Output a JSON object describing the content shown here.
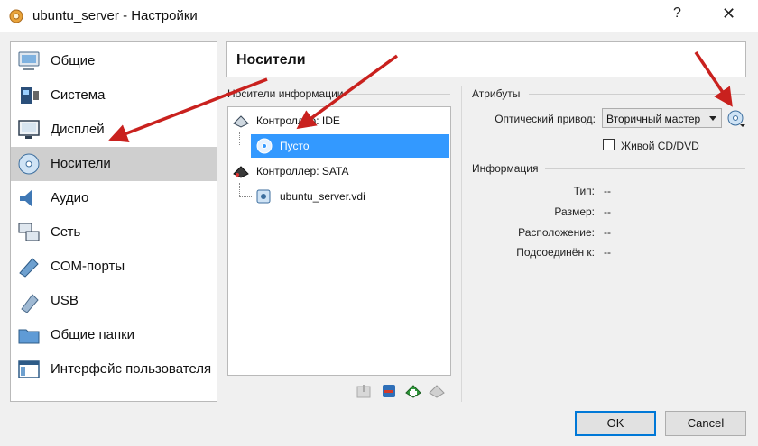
{
  "window": {
    "title": "ubuntu_server - Настройки",
    "help_glyph": "?",
    "close_glyph": "✕"
  },
  "sidebar": {
    "items": [
      {
        "label": "Общие",
        "icon": "general-icon"
      },
      {
        "label": "Система",
        "icon": "system-icon"
      },
      {
        "label": "Дисплей",
        "icon": "display-icon"
      },
      {
        "label": "Носители",
        "icon": "storage-icon",
        "selected": true
      },
      {
        "label": "Аудио",
        "icon": "audio-icon"
      },
      {
        "label": "Сеть",
        "icon": "network-icon"
      },
      {
        "label": "COM-порты",
        "icon": "serial-ports-icon"
      },
      {
        "label": "USB",
        "icon": "usb-icon"
      },
      {
        "label": "Общие папки",
        "icon": "shared-folders-icon"
      },
      {
        "label": "Интерфейс пользователя",
        "icon": "user-interface-icon"
      }
    ]
  },
  "page": {
    "title": "Носители"
  },
  "storage": {
    "group_title": "Носители информации",
    "tree": [
      {
        "label": "Контроллер: IDE",
        "type": "controller"
      },
      {
        "label": "Пусто",
        "type": "optical",
        "selected": true
      },
      {
        "label": "Контроллер: SATA",
        "type": "controller"
      },
      {
        "label": "ubuntu_server.vdi",
        "type": "disk"
      }
    ]
  },
  "attributes": {
    "group_title": "Атрибуты",
    "optical_drive_label": "Оптический привод:",
    "optical_drive_value": "Вторичный мастер",
    "live_cd_label": "Живой CD/DVD",
    "live_cd_checked": false
  },
  "information": {
    "group_title": "Информация",
    "rows": [
      {
        "label": "Тип:",
        "value": "--"
      },
      {
        "label": "Размер:",
        "value": "--"
      },
      {
        "label": "Расположение:",
        "value": "--"
      },
      {
        "label": "Подсоединён к:",
        "value": "--"
      }
    ]
  },
  "buttons": {
    "ok": "OK",
    "cancel": "Cancel"
  },
  "colors": {
    "selection": "#3399ff",
    "annotation_arrow": "#c9211e",
    "default_button_border": "#0078d7"
  }
}
